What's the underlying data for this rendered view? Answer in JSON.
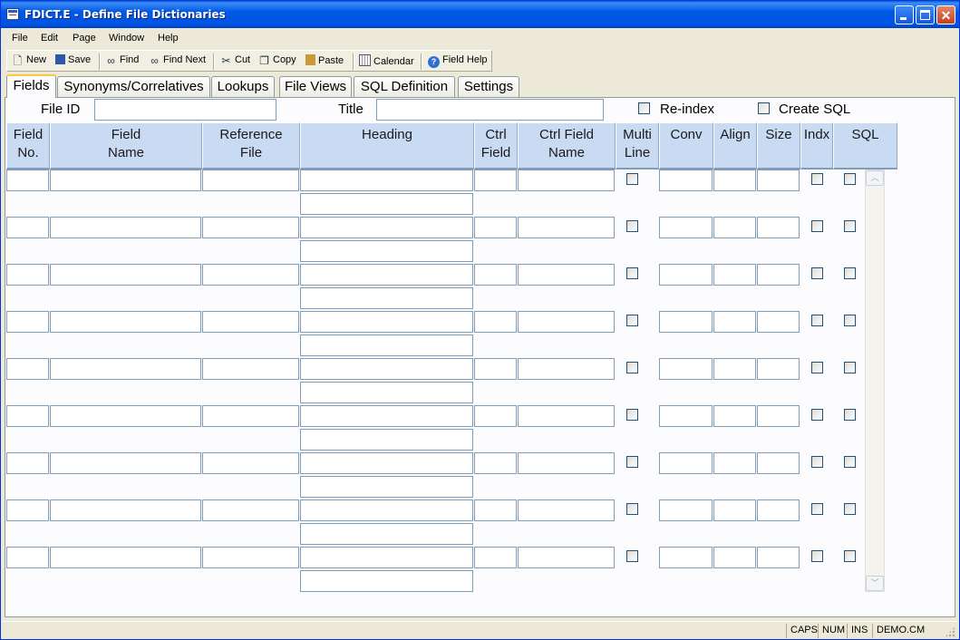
{
  "window": {
    "title": "FDICT.E - Define File Dictionaries",
    "controls": {
      "minimize": "",
      "maximize": "",
      "close": "✕"
    }
  },
  "menu": [
    "File",
    "Edit",
    "Page",
    "Window",
    "Help"
  ],
  "toolbar": [
    {
      "id": "new",
      "label": "New",
      "icon": "new-document-icon"
    },
    {
      "id": "save",
      "label": "Save",
      "icon": "floppy-disk-icon"
    },
    {
      "id": "find",
      "label": "Find",
      "icon": "binoculars-icon"
    },
    {
      "id": "find-next",
      "label": "Find Next",
      "icon": "binoculars-next-icon"
    },
    {
      "id": "cut",
      "label": "Cut",
      "icon": "scissors-icon"
    },
    {
      "id": "copy",
      "label": "Copy",
      "icon": "copy-icon"
    },
    {
      "id": "paste",
      "label": "Paste",
      "icon": "clipboard-icon"
    },
    {
      "id": "calendar",
      "label": "Calendar",
      "icon": "calendar-icon"
    },
    {
      "id": "field-help",
      "label": "Field Help",
      "icon": "help-icon"
    }
  ],
  "tabs": [
    "Fields",
    "Synonyms/Correlatives",
    "Lookups",
    "File Views",
    "SQL Definition",
    "Settings"
  ],
  "active_tab": "Fields",
  "form": {
    "file_id_label": "File ID",
    "file_id_value": "",
    "title_label": "Title",
    "title_value": "",
    "reindex_label": "Re-index",
    "create_sql_label": "Create SQL"
  },
  "grid": {
    "columns": [
      {
        "key": "field_no",
        "label": "Field\nNo."
      },
      {
        "key": "field_name",
        "label": "Field\nName"
      },
      {
        "key": "reference_file",
        "label": "Reference\nFile"
      },
      {
        "key": "heading",
        "label": "Heading"
      },
      {
        "key": "ctrl_field",
        "label": "Ctrl\nField"
      },
      {
        "key": "ctrl_field_name",
        "label": "Ctrl Field\nName"
      },
      {
        "key": "multi_line",
        "label": "Multi\nLine"
      },
      {
        "key": "conv",
        "label": "Conv"
      },
      {
        "key": "align",
        "label": "Align"
      },
      {
        "key": "size",
        "label": "Size"
      },
      {
        "key": "indx",
        "label": "Indx"
      },
      {
        "key": "sql",
        "label": "SQL"
      }
    ],
    "row_count": 9
  },
  "status": [
    "CAPS",
    "NUM",
    "INS",
    "DEMO.CM"
  ]
}
